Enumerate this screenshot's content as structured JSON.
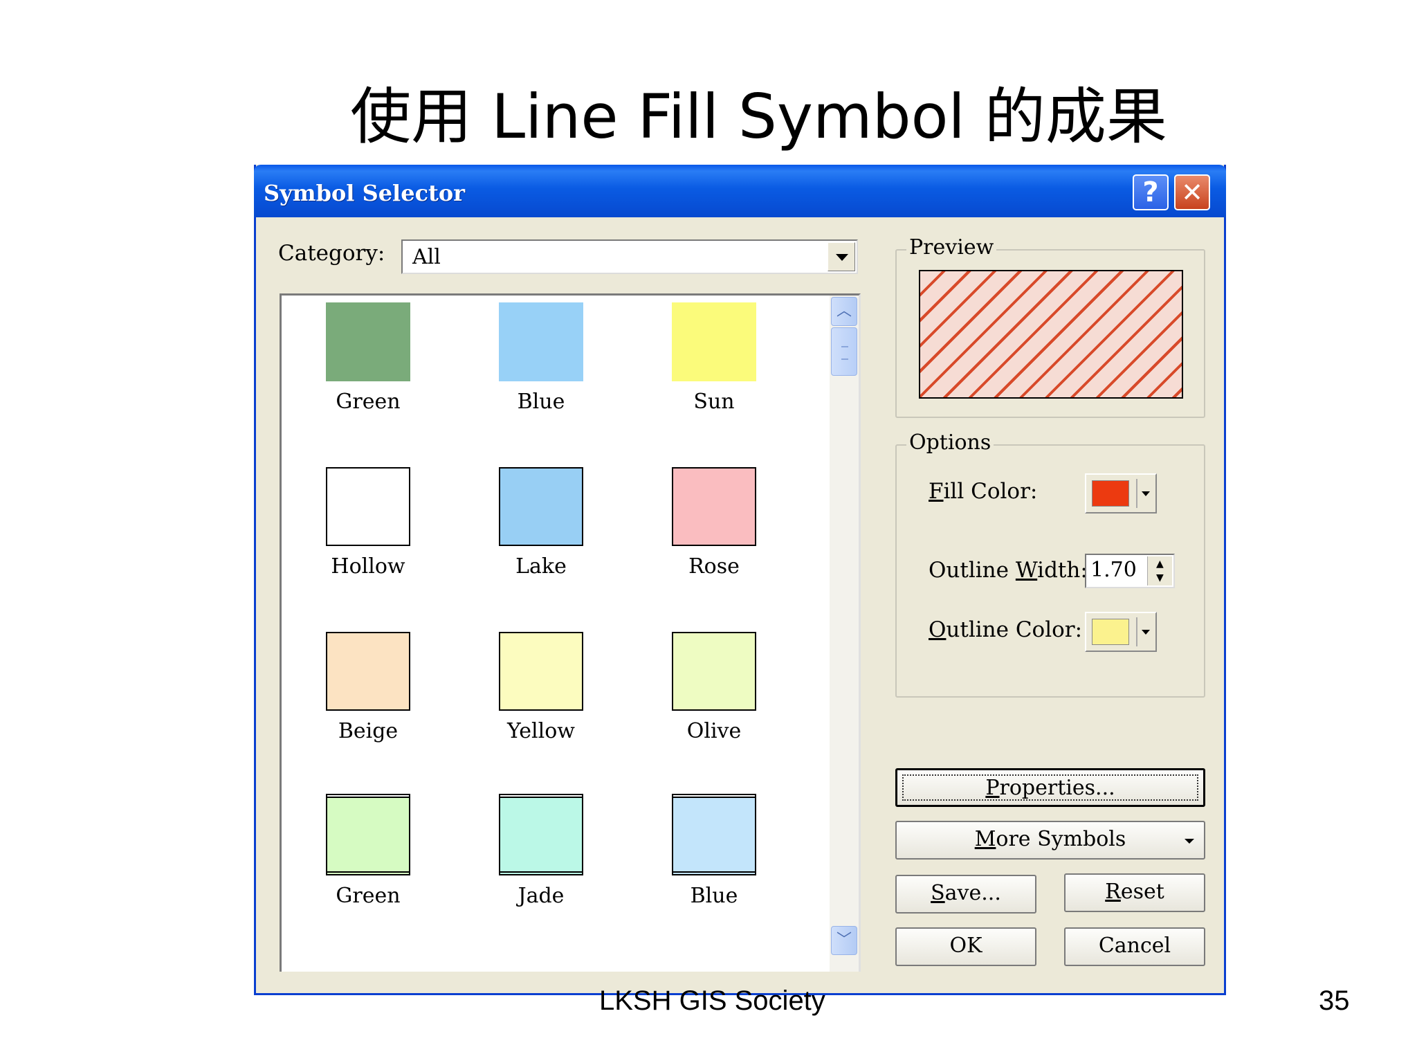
{
  "slide": {
    "title": "使用 Line Fill Symbol 的成果",
    "footer": "LKSH  GIS Society",
    "page_number": "35"
  },
  "dialog": {
    "title": "Symbol Selector",
    "help_glyph": "?",
    "close_glyph": "✕",
    "category_label": "Category:",
    "category_value": "All",
    "symbols": [
      {
        "name": "Green",
        "color": "#7aab7a"
      },
      {
        "name": "Blue",
        "color": "#98d1f7"
      },
      {
        "name": "Sun",
        "color": "#fbfb7b"
      },
      {
        "name": "Hollow",
        "color": "#ffffff"
      },
      {
        "name": "Lake",
        "color": "#98cff4"
      },
      {
        "name": "Rose",
        "color": "#fabdc0"
      },
      {
        "name": "Beige",
        "color": "#fce3c2"
      },
      {
        "name": "Yellow",
        "color": "#fcfcbf"
      },
      {
        "name": "Olive",
        "color": "#eefcc2"
      },
      {
        "name": "Green",
        "color": "#d6fbc2"
      },
      {
        "name": "Jade",
        "color": "#bbf8e7"
      },
      {
        "name": "Blue",
        "color": "#c3e5fb"
      }
    ],
    "preview_label": "Preview",
    "preview_colors": {
      "fill_line": "#d84a2a",
      "background": "#f6dcd4"
    },
    "options_label": "Options",
    "fill_color_label_u": "F",
    "fill_color_label_rest": "ill Color:",
    "fill_color": "#ec3a10",
    "outline_width_label_pre": "Outline ",
    "outline_width_label_u": "W",
    "outline_width_label_rest": "idth:",
    "outline_width_value": "1.70",
    "outline_color_label_u": "O",
    "outline_color_label_rest": "utline Color:",
    "outline_color": "#fbf28e",
    "properties_u": "P",
    "properties_rest": "roperties...",
    "more_symbols_u": "M",
    "more_symbols_rest": "ore Symbols",
    "save_u": "S",
    "save_rest": "ave...",
    "reset_u": "R",
    "reset_rest": "eset",
    "ok_label": "OK",
    "cancel_label": "Cancel",
    "scroll_up_glyph": "︿",
    "scroll_down_glyph": "﹀"
  }
}
